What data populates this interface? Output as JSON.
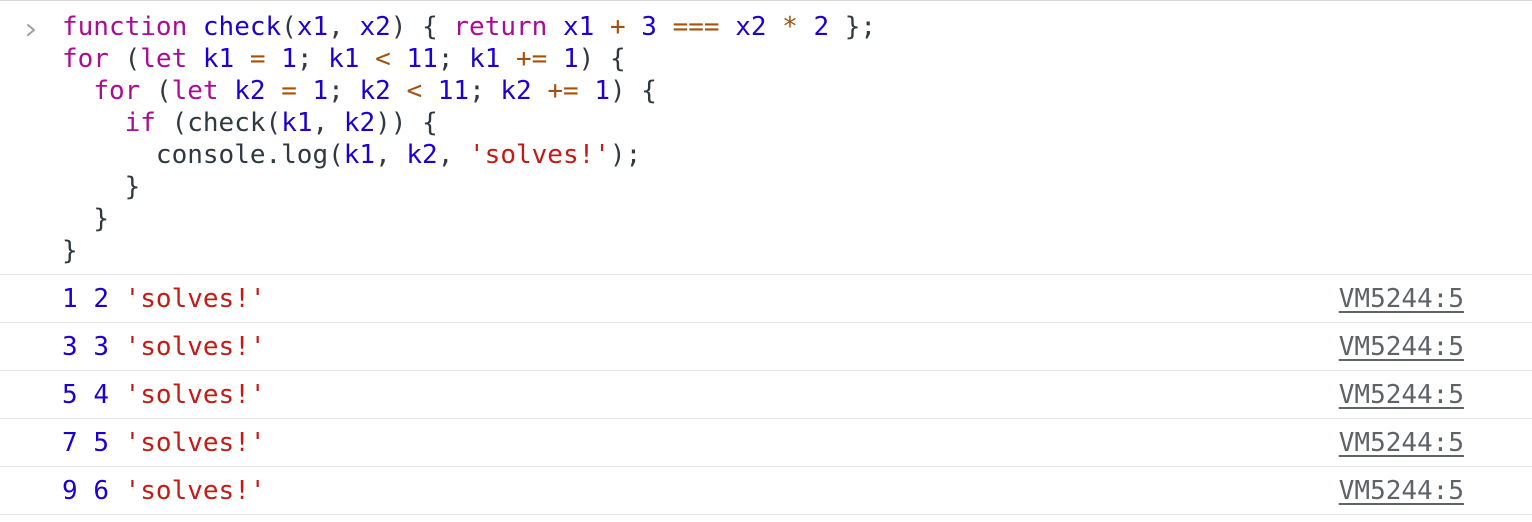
{
  "input": {
    "prompt_icon": "chevron-right-icon",
    "lines": [
      [
        {
          "t": "kw",
          "v": "function"
        },
        {
          "t": "plain",
          "v": " "
        },
        {
          "t": "def",
          "v": "check"
        },
        {
          "t": "punc",
          "v": "("
        },
        {
          "t": "def",
          "v": "x1"
        },
        {
          "t": "punc",
          "v": ", "
        },
        {
          "t": "def",
          "v": "x2"
        },
        {
          "t": "punc",
          "v": ") { "
        },
        {
          "t": "kw",
          "v": "return"
        },
        {
          "t": "plain",
          "v": " "
        },
        {
          "t": "var",
          "v": "x1"
        },
        {
          "t": "plain",
          "v": " "
        },
        {
          "t": "op",
          "v": "+"
        },
        {
          "t": "plain",
          "v": " "
        },
        {
          "t": "num",
          "v": "3"
        },
        {
          "t": "plain",
          "v": " "
        },
        {
          "t": "op",
          "v": "==="
        },
        {
          "t": "plain",
          "v": " "
        },
        {
          "t": "var",
          "v": "x2"
        },
        {
          "t": "plain",
          "v": " "
        },
        {
          "t": "op",
          "v": "*"
        },
        {
          "t": "plain",
          "v": " "
        },
        {
          "t": "num",
          "v": "2"
        },
        {
          "t": "punc",
          "v": " };"
        }
      ],
      [
        {
          "t": "kw",
          "v": "for"
        },
        {
          "t": "punc",
          "v": " ("
        },
        {
          "t": "kw",
          "v": "let"
        },
        {
          "t": "plain",
          "v": " "
        },
        {
          "t": "def",
          "v": "k1"
        },
        {
          "t": "plain",
          "v": " "
        },
        {
          "t": "op",
          "v": "="
        },
        {
          "t": "plain",
          "v": " "
        },
        {
          "t": "num",
          "v": "1"
        },
        {
          "t": "punc",
          "v": "; "
        },
        {
          "t": "var",
          "v": "k1"
        },
        {
          "t": "plain",
          "v": " "
        },
        {
          "t": "op",
          "v": "<"
        },
        {
          "t": "plain",
          "v": " "
        },
        {
          "t": "num",
          "v": "11"
        },
        {
          "t": "punc",
          "v": "; "
        },
        {
          "t": "var",
          "v": "k1"
        },
        {
          "t": "plain",
          "v": " "
        },
        {
          "t": "op",
          "v": "+="
        },
        {
          "t": "plain",
          "v": " "
        },
        {
          "t": "num",
          "v": "1"
        },
        {
          "t": "punc",
          "v": ") {"
        }
      ],
      [
        {
          "t": "plain",
          "v": "  "
        },
        {
          "t": "kw",
          "v": "for"
        },
        {
          "t": "punc",
          "v": " ("
        },
        {
          "t": "kw",
          "v": "let"
        },
        {
          "t": "plain",
          "v": " "
        },
        {
          "t": "def",
          "v": "k2"
        },
        {
          "t": "plain",
          "v": " "
        },
        {
          "t": "op",
          "v": "="
        },
        {
          "t": "plain",
          "v": " "
        },
        {
          "t": "num",
          "v": "1"
        },
        {
          "t": "punc",
          "v": "; "
        },
        {
          "t": "var",
          "v": "k2"
        },
        {
          "t": "plain",
          "v": " "
        },
        {
          "t": "op",
          "v": "<"
        },
        {
          "t": "plain",
          "v": " "
        },
        {
          "t": "num",
          "v": "11"
        },
        {
          "t": "punc",
          "v": "; "
        },
        {
          "t": "var",
          "v": "k2"
        },
        {
          "t": "plain",
          "v": " "
        },
        {
          "t": "op",
          "v": "+="
        },
        {
          "t": "plain",
          "v": " "
        },
        {
          "t": "num",
          "v": "1"
        },
        {
          "t": "punc",
          "v": ") {"
        }
      ],
      [
        {
          "t": "plain",
          "v": "    "
        },
        {
          "t": "kw",
          "v": "if"
        },
        {
          "t": "punc",
          "v": " ("
        },
        {
          "t": "plain",
          "v": "check"
        },
        {
          "t": "punc",
          "v": "("
        },
        {
          "t": "var",
          "v": "k1"
        },
        {
          "t": "punc",
          "v": ", "
        },
        {
          "t": "var",
          "v": "k2"
        },
        {
          "t": "punc",
          "v": ")) {"
        }
      ],
      [
        {
          "t": "plain",
          "v": "      "
        },
        {
          "t": "plain",
          "v": "console"
        },
        {
          "t": "punc",
          "v": "."
        },
        {
          "t": "plain",
          "v": "log"
        },
        {
          "t": "punc",
          "v": "("
        },
        {
          "t": "var",
          "v": "k1"
        },
        {
          "t": "punc",
          "v": ", "
        },
        {
          "t": "var",
          "v": "k2"
        },
        {
          "t": "punc",
          "v": ", "
        },
        {
          "t": "str",
          "v": "'solves!'"
        },
        {
          "t": "punc",
          "v": ");"
        }
      ],
      [
        {
          "t": "plain",
          "v": "    "
        },
        {
          "t": "punc",
          "v": "}"
        }
      ],
      [
        {
          "t": "plain",
          "v": "  "
        },
        {
          "t": "punc",
          "v": "}"
        }
      ],
      [
        {
          "t": "punc",
          "v": "}"
        }
      ]
    ]
  },
  "output": {
    "rows": [
      {
        "k1": "1",
        "k2": "2",
        "msg": "'solves!'",
        "source": "VM5244:5"
      },
      {
        "k1": "3",
        "k2": "3",
        "msg": "'solves!'",
        "source": "VM5244:5"
      },
      {
        "k1": "5",
        "k2": "4",
        "msg": "'solves!'",
        "source": "VM5244:5"
      },
      {
        "k1": "7",
        "k2": "5",
        "msg": "'solves!'",
        "source": "VM5244:5"
      },
      {
        "k1": "9",
        "k2": "6",
        "msg": "'solves!'",
        "source": "VM5244:5"
      }
    ]
  },
  "colors": {
    "keyword": "#aa0d91",
    "identifier": "#1c00cf",
    "operator": "#a1520f",
    "string": "#c41a16",
    "plain": "#303942",
    "source_link": "#5f6368",
    "row_divider": "#e4e4e4"
  }
}
